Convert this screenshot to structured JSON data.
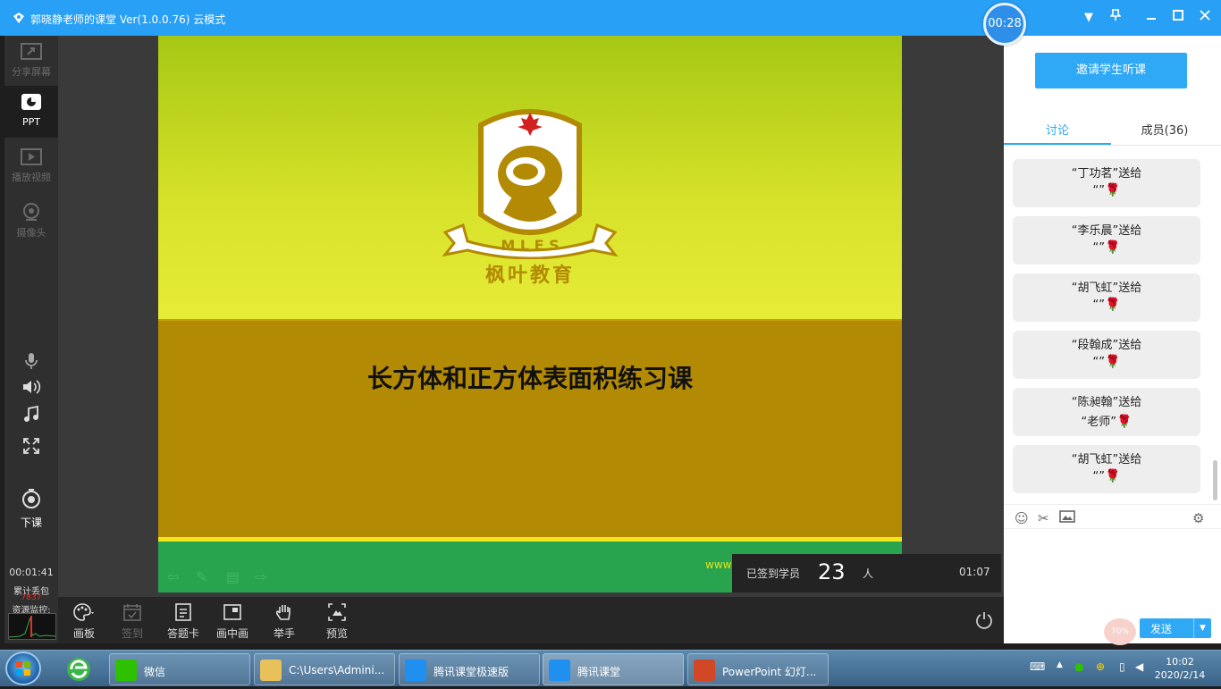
{
  "window": {
    "title": "郭晓静老师的课堂 Ver(1.0.0.76)  云模式",
    "timer": "00:28"
  },
  "leftbar": {
    "items": [
      {
        "label": "分享屏幕",
        "icon": "share-screen-icon"
      },
      {
        "label": "PPT",
        "icon": "ppt-icon"
      },
      {
        "label": "播放视频",
        "icon": "play-video-icon"
      },
      {
        "label": "摄像头",
        "icon": "camera-icon"
      }
    ],
    "end_class": "下课",
    "elapsed": "00:01:41",
    "loss_label": "累计丢包",
    "loss_value": "7837",
    "monitor_label": "资源监控:"
  },
  "slide": {
    "logo_text": "枫叶教育",
    "logo_banner": "M L E S",
    "title": "长方体和正方体表面积练习课",
    "website": "www"
  },
  "checkin": {
    "label": "已签到学员",
    "count": "23",
    "unit": "人",
    "time": "01:07"
  },
  "toolbar": {
    "items": [
      {
        "label": "画板",
        "enabled": true
      },
      {
        "label": "签到",
        "enabled": false
      },
      {
        "label": "答题卡",
        "enabled": true
      },
      {
        "label": "画中画",
        "enabled": true
      },
      {
        "label": "举手",
        "enabled": true
      },
      {
        "label": "预览",
        "enabled": true
      }
    ]
  },
  "right": {
    "invite_label": "邀请学生听课",
    "tab_discuss": "讨论",
    "tab_members": "成员(36)",
    "messages": [
      {
        "line1": "“丁功茗”送给",
        "line2": "“”"
      },
      {
        "line1": "“李乐晨”送给",
        "line2": "“”"
      },
      {
        "line1": "“胡飞虹”送给",
        "line2": "“”"
      },
      {
        "line1": "“段翰成”送给",
        "line2": "“”"
      },
      {
        "line1": "“陈昶翰”送给",
        "line2": "“老师”"
      },
      {
        "line1": "“胡飞虹”送给",
        "line2": "“”"
      }
    ],
    "send_label": "发送",
    "badge": "70%"
  },
  "taskbar": {
    "items": [
      {
        "label": "微信"
      },
      {
        "label": "C:\\Users\\Admini..."
      },
      {
        "label": "腾讯课堂极速版"
      },
      {
        "label": "腾讯课堂"
      },
      {
        "label": "PowerPoint 幻灯..."
      }
    ],
    "time": "10:02",
    "date": "2020/2/14"
  },
  "colors": {
    "accent": "#2fa8f6",
    "slide_top": "#d8e22a",
    "slide_mid": "#b28a04",
    "slide_bottom": "#27a44d"
  }
}
